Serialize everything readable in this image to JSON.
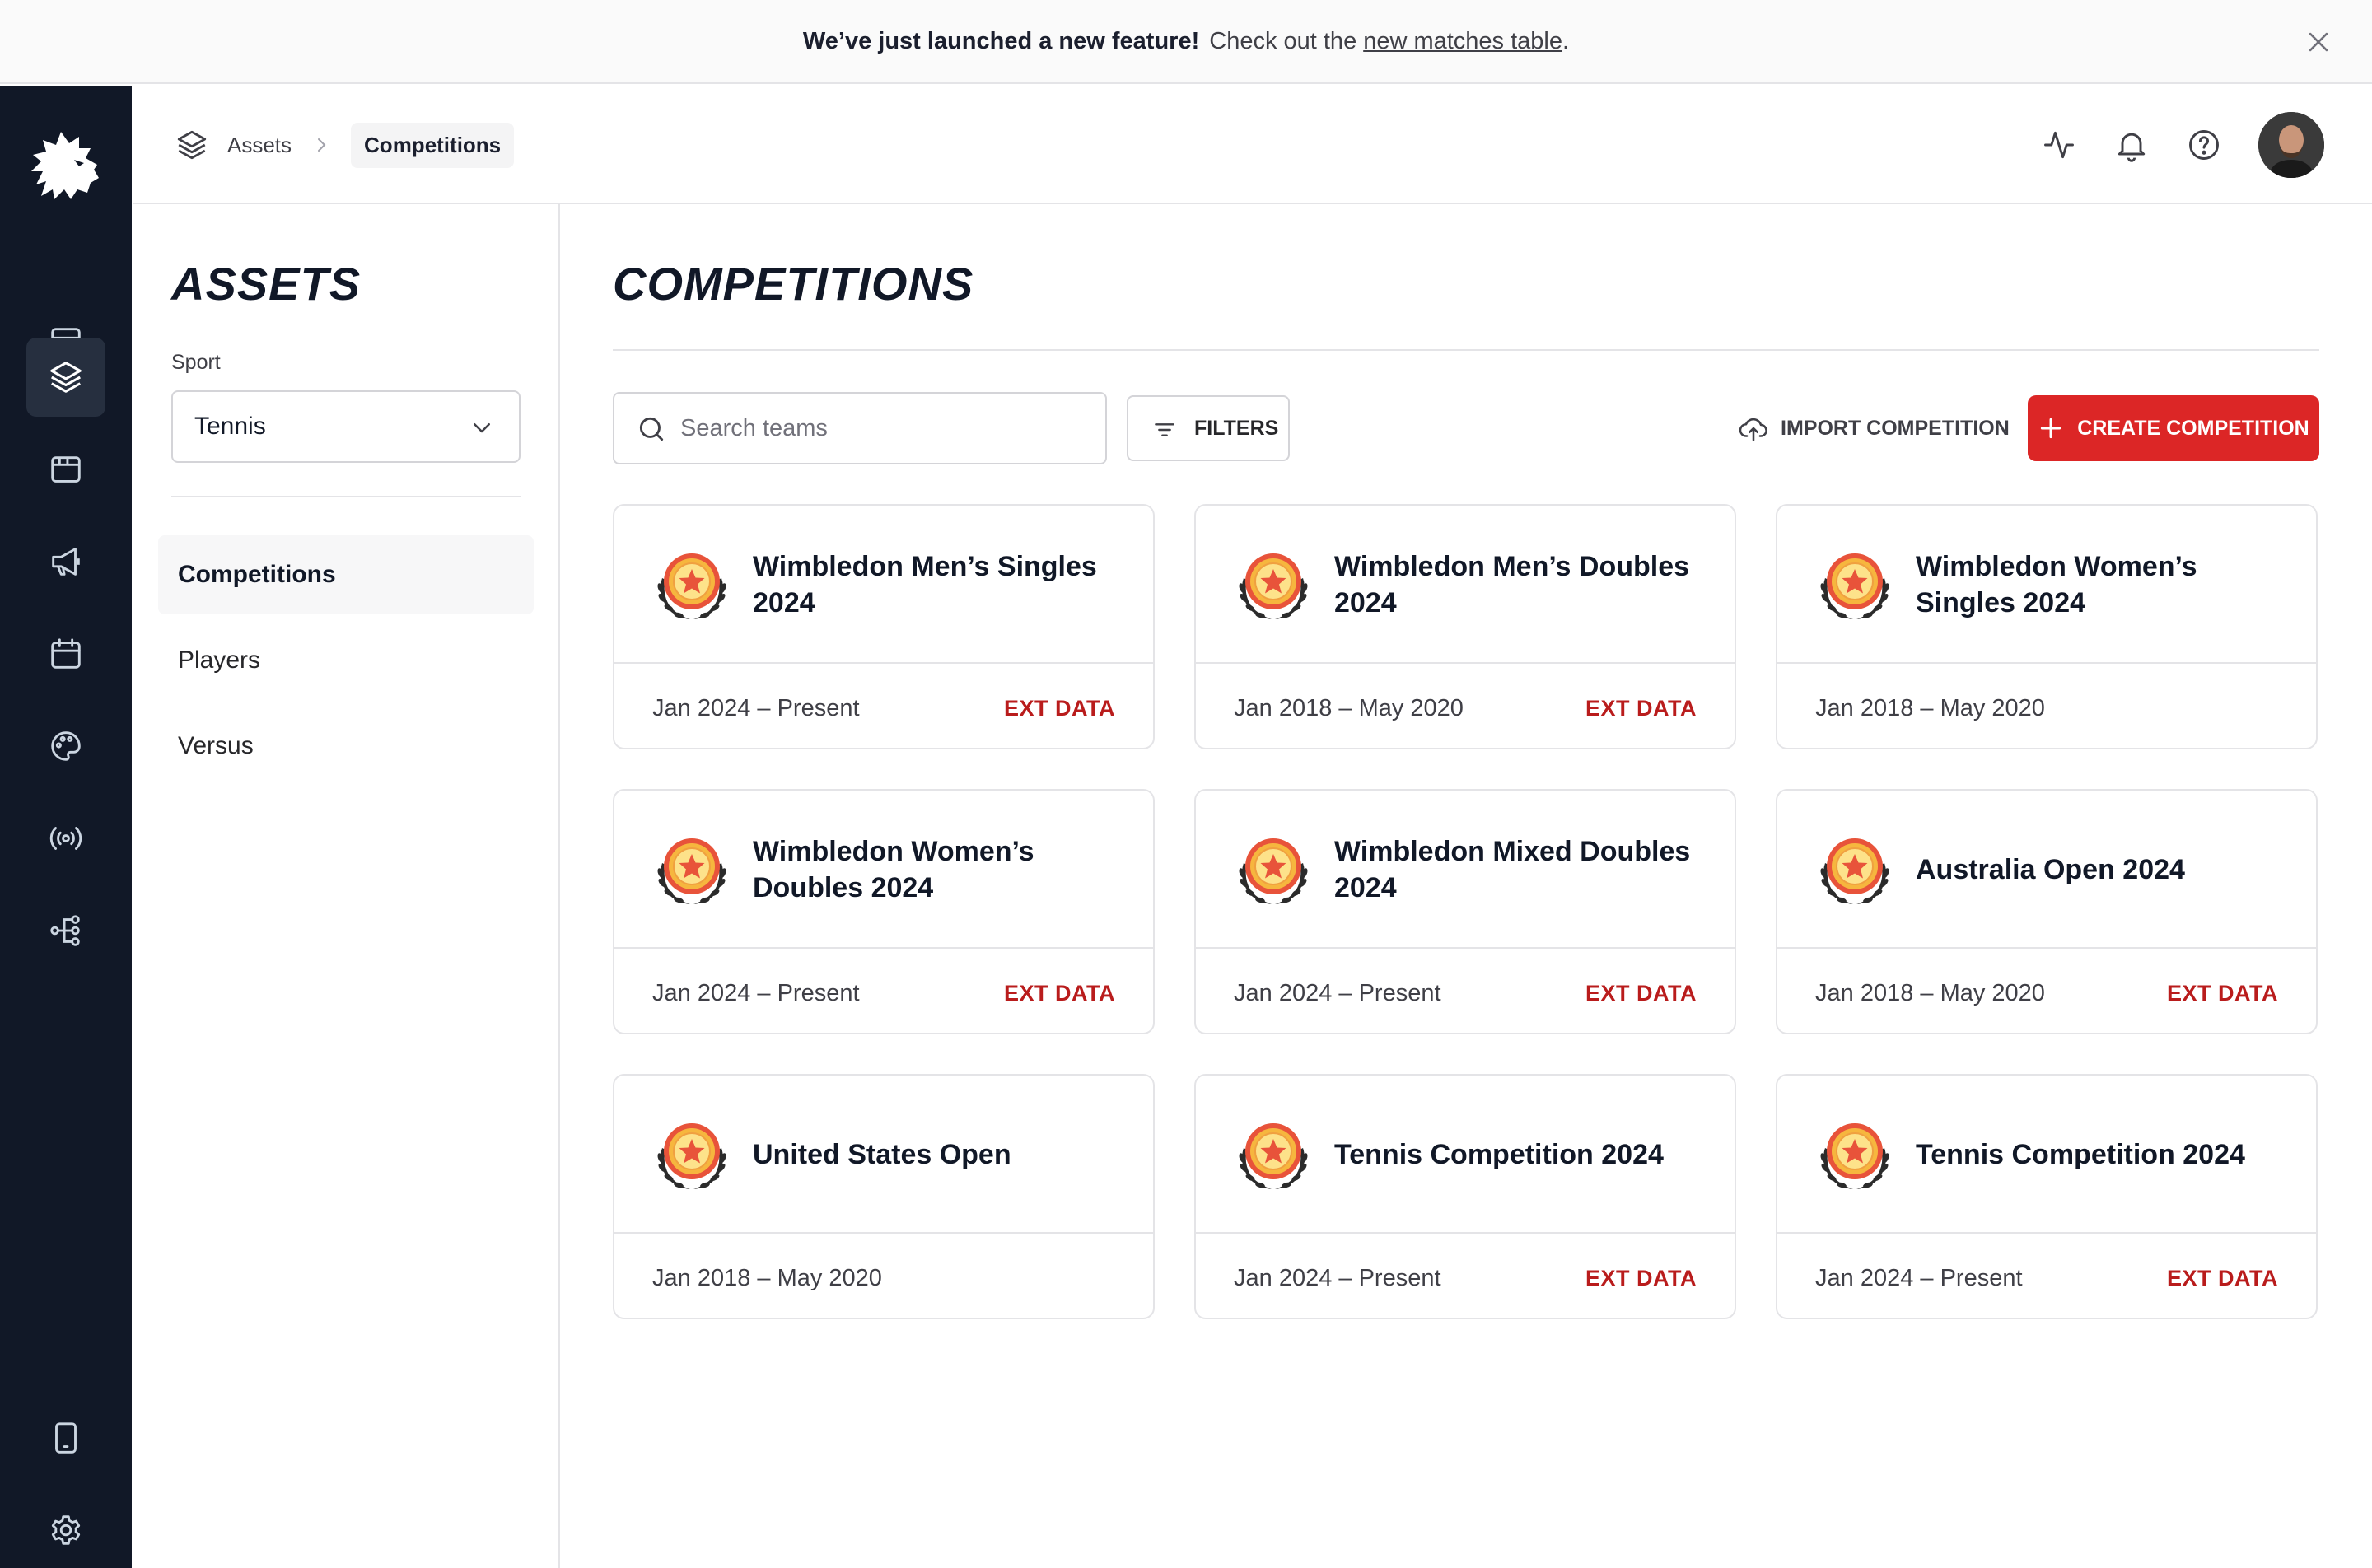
{
  "banner": {
    "headline": "We’ve just launched a new feature!",
    "text": "Check out the",
    "link": "new matches table",
    "suffix": "."
  },
  "breadcrumb": {
    "root": "Assets",
    "current": "Competitions"
  },
  "sidebar": {
    "title": "ASSETS",
    "sport_label": "Sport",
    "sport_value": "Tennis",
    "items": [
      {
        "label": "Competitions",
        "active": true
      },
      {
        "label": "Players",
        "active": false
      },
      {
        "label": "Versus",
        "active": false
      }
    ]
  },
  "main": {
    "title": "COMPETITIONS",
    "search_placeholder": "Search teams",
    "filters_label": "FILTERS",
    "import_label": "IMPORT COMPETITION",
    "create_label": "CREATE COMPETITION"
  },
  "competitions": [
    {
      "name": "Wimbledon Men’s Singles 2024",
      "dates": "Jan 2024 – Present",
      "badge": "EXT DATA"
    },
    {
      "name": "Wimbledon Men’s Doubles 2024",
      "dates": "Jan 2018 – May 2020",
      "badge": "EXT DATA"
    },
    {
      "name": "Wimbledon Women’s Singles 2024",
      "dates": "Jan 2018 – May 2020",
      "badge": ""
    },
    {
      "name": "Wimbledon Women’s Doubles 2024",
      "dates": "Jan 2024 – Present",
      "badge": "EXT DATA"
    },
    {
      "name": "Wimbledon Mixed Doubles 2024",
      "dates": "Jan 2024 – Present",
      "badge": "EXT DATA"
    },
    {
      "name": "Australia Open 2024",
      "dates": "Jan 2018 – May 2020",
      "badge": "EXT DATA"
    },
    {
      "name": "United States Open",
      "dates": "Jan 2018 – May 2020",
      "badge": ""
    },
    {
      "name": "Tennis Competition 2024",
      "dates": "Jan 2024 – Present",
      "badge": "EXT DATA"
    },
    {
      "name": "Tennis Competition 2024",
      "dates": "Jan 2024 – Present",
      "badge": "EXT DATA"
    }
  ],
  "icons": {
    "rail": [
      "lion-logo",
      "layout-icon",
      "layers-icon",
      "browser-icon",
      "megaphone-icon",
      "calendar-icon",
      "palette-icon",
      "broadcast-icon",
      "workflow-icon",
      "tablet-icon",
      "gear-icon"
    ],
    "header": [
      "activity-icon",
      "bell-icon",
      "help-icon"
    ]
  },
  "colors": {
    "accent": "#dc2626",
    "ext_badge": "#b91c1c",
    "rail": "#111827"
  }
}
